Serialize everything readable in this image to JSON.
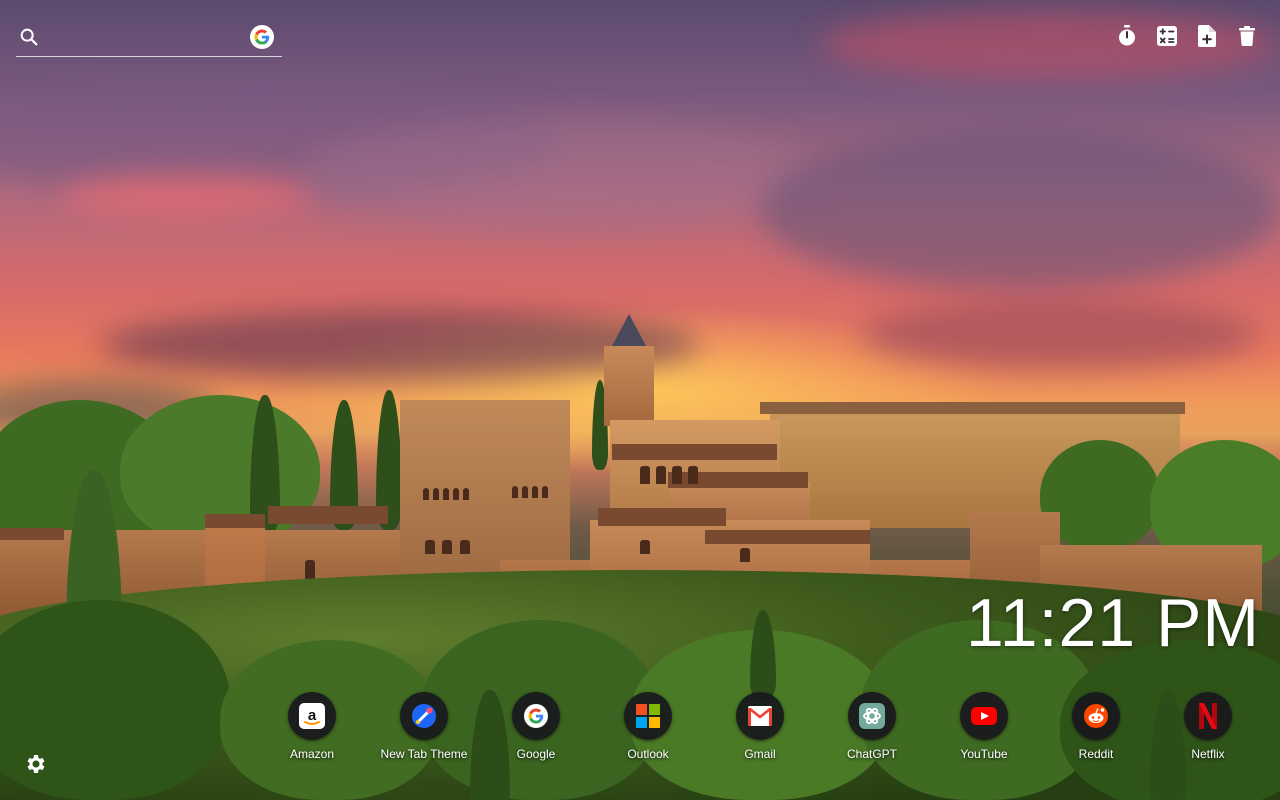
{
  "search": {
    "placeholder": "",
    "engine_icon": "google-g-icon"
  },
  "toolbar": {
    "items": [
      {
        "icon": "timer-icon"
      },
      {
        "icon": "calculator-icon"
      },
      {
        "icon": "add-file-icon"
      },
      {
        "icon": "trash-icon"
      }
    ]
  },
  "clock": {
    "time": "11:21 PM"
  },
  "shortcuts": [
    {
      "label": "Amazon",
      "icon": "amazon-icon"
    },
    {
      "label": "New Tab Theme",
      "icon": "new-tab-theme-icon"
    },
    {
      "label": "Google",
      "icon": "google-icon"
    },
    {
      "label": "Outlook",
      "icon": "outlook-icon"
    },
    {
      "label": "Gmail",
      "icon": "gmail-icon"
    },
    {
      "label": "ChatGPT",
      "icon": "chatgpt-icon"
    },
    {
      "label": "YouTube",
      "icon": "youtube-icon"
    },
    {
      "label": "Reddit",
      "icon": "reddit-icon"
    },
    {
      "label": "Netflix",
      "icon": "netflix-icon"
    }
  ],
  "settings": {
    "icon": "gear-icon"
  },
  "colors": {
    "accent_text": "#ffffff",
    "shortcut_bg": "#18181c",
    "youtube_red": "#ff0000",
    "netflix_red": "#e50914",
    "reddit_orange": "#ff4500"
  }
}
